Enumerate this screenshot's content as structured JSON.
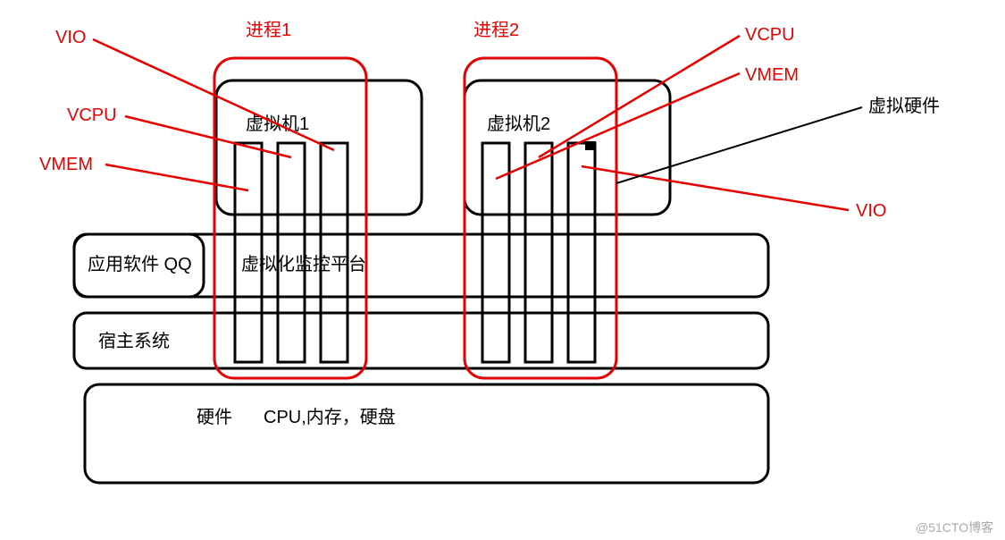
{
  "labels": {
    "vio_left": "VIO",
    "vcpu_left": "VCPU",
    "vmem_left": "VMEM",
    "process1": "进程1",
    "process2": "进程2",
    "vcpu_right": "VCPU",
    "vmem_right": "VMEM",
    "virtual_hw": "虚拟硬件",
    "vio_right": "VIO",
    "vm1": "虚拟机1",
    "vm2": "虚拟机2",
    "app_qq": "应用软件 QQ",
    "hypervisor": "虚拟化监控平台",
    "host_os": "宿主系统",
    "hw": "硬件",
    "hw_detail": "CPU,内存，硬盘",
    "watermark": "@51CTO博客"
  },
  "diagram": {
    "layers_bottom_to_top": [
      "硬件 CPU,内存，硬盘",
      "宿主系统",
      "虚拟化监控平台 / 应用软件 QQ",
      "进程1(虚拟机1)",
      "进程2(虚拟机2)"
    ],
    "process1_threads": [
      "VMEM",
      "VCPU",
      "VIO"
    ],
    "process2_threads": [
      "VMEM",
      "VCPU",
      "VIO"
    ],
    "right_annotation": "虚拟硬件"
  }
}
